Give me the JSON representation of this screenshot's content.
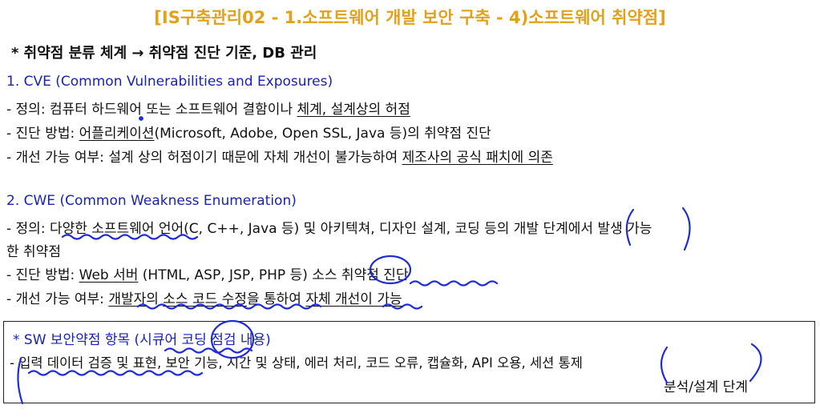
{
  "title": "[IS구축관리02 - 1.소프트웨어 개발 보안 구축 - 4)소프트웨어 취약점]",
  "subtitle": "* 취약점 분류 체계 → 취약점 진단 기준, DB 관리",
  "cve": {
    "heading": "1. CVE (Common Vulnerabilities and Exposures)",
    "def_prefix": "- 정의: 컴퓨터 하드웨어 또는 소프트웨어 결함이나 ",
    "def_underlined": "체계, 설계상의 허점",
    "method_prefix": "- 진단 방법: ",
    "method_underlined": "어플리케이션",
    "method_rest": "(Microsoft, Adobe, Open SSL, Java 등)의 취약점 진단",
    "improve_prefix": "- 개선 가능 여부: 설계 상의 허점이기 때문에 자체 개선이 불가능하여 ",
    "improve_underlined": "제조사의 공식 패치에 의존"
  },
  "cwe": {
    "heading": "2. CWE (Common Weakness Enumeration)",
    "def_line1": "- 정의: 다양한 소프트웨어 언어(C, C++, Java 등) 및 아키텍쳐, 디자인 설계, 코딩 등의 개발 단계에서 발생 가능",
    "def_line2": "한 취약점",
    "method_prefix": "- 진단 방법: ",
    "method_underlined": "Web 서버",
    "method_rest": " (HTML, ASP, JSP, PHP 등) 소스 취약점 진단",
    "improve_prefix": "- 개선 가능 여부: ",
    "improve_a": "개발자",
    "improve_b": "의 ",
    "improve_c": "소스 코드 수정",
    "improve_d": "을 통하여 ",
    "improve_e": "자체 개선이 가능"
  },
  "box": {
    "heading": "* SW 보안약점 항목 (시큐어 코딩 점검 내용)",
    "items": "- 입력 데이터 검증 및 표현, 보안 기능, 시간 및 상태, 에러 처리, 코드 오류, 캡슐화, API 오용, 세션 통제",
    "note": "분석/설계 단계"
  },
  "colors": {
    "title": "#e0a21a",
    "heading_blue": "#1a22b0",
    "ink_blue": "#1f2bd6"
  }
}
